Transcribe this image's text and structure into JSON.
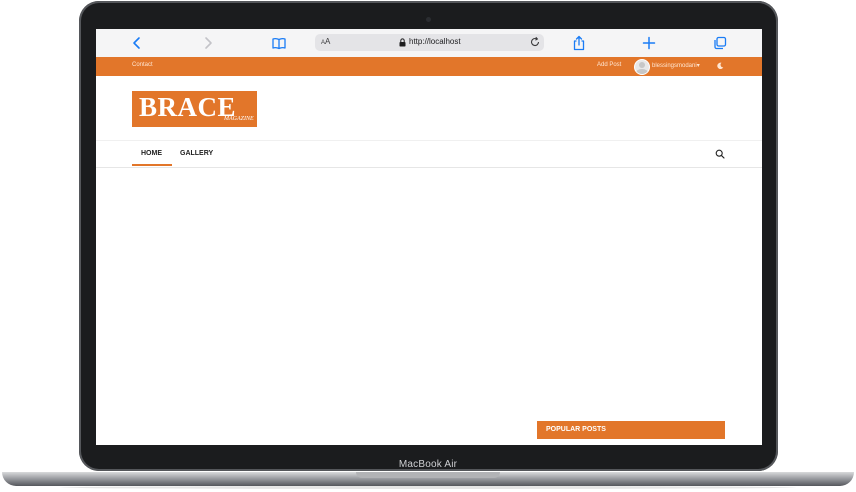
{
  "device": {
    "label": "MacBook Air"
  },
  "browser": {
    "url": "http://localhost",
    "text_size_label_small": "A",
    "text_size_label_large": "A",
    "icons": [
      "back-icon",
      "forward-icon",
      "bookmarks-icon",
      "reload-icon",
      "share-icon",
      "new-tab-icon",
      "tabs-icon"
    ]
  },
  "topbar": {
    "contact": "Contact",
    "add_post": "Add Post",
    "username": "blessingsmodani",
    "dropdown_caret": "▾",
    "background": "#e2762a"
  },
  "logo": {
    "main": "BRACE",
    "sub": "MAGAZINE"
  },
  "nav": {
    "items": [
      {
        "label": "HOME",
        "active": true
      },
      {
        "label": "GALLERY",
        "active": false
      }
    ]
  },
  "sidebar": {
    "popular_title": "POPULAR POSTS"
  },
  "colors": {
    "accent": "#e2762a",
    "browser_blue": "#1a7cf5"
  }
}
